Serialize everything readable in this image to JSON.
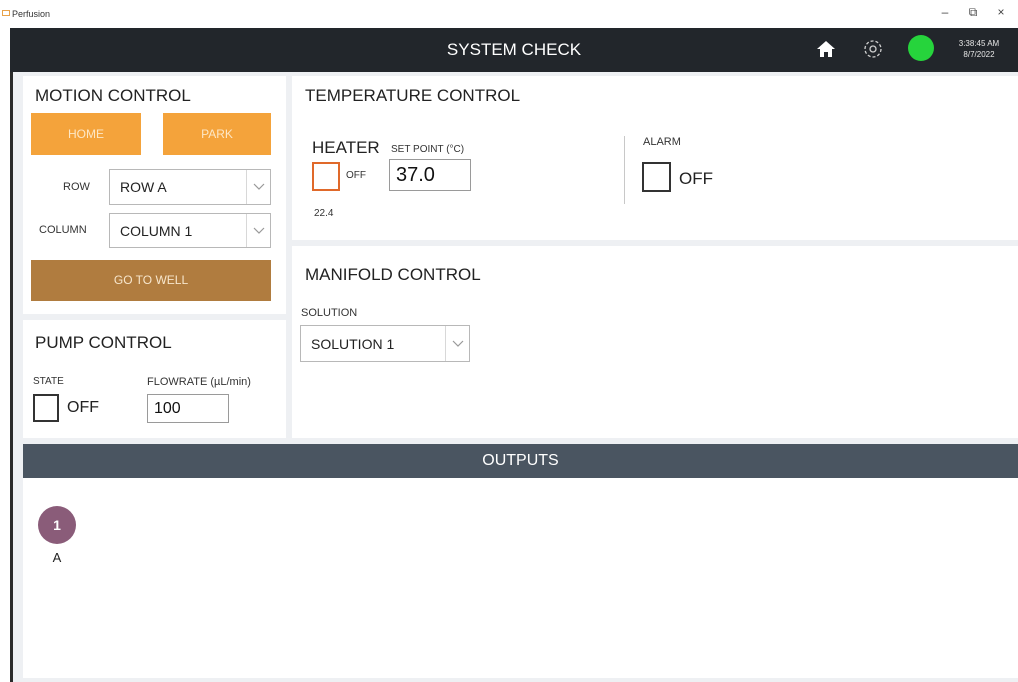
{
  "window": {
    "app_title": "Perfusion",
    "minimize": "–",
    "restore": "⧉",
    "close": "×"
  },
  "header": {
    "title": "SYSTEM CHECK",
    "time": "3:38:45 AM",
    "date": "8/7/2022",
    "status_color": "#26d43c",
    "icons": [
      "home-icon",
      "gear-icon"
    ]
  },
  "motion_control": {
    "title": "MOTION CONTROL",
    "home_label": "HOME",
    "park_label": "PARK",
    "row_label": "ROW",
    "row_value": "ROW A",
    "column_label": "COLUMN",
    "column_value": "COLUMN 1",
    "go_to_well_label": "GO TO WELL"
  },
  "pump_control": {
    "title": "PUMP CONTROL",
    "state_label": "STATE",
    "state_value": "OFF",
    "flowrate_label": "FLOWRATE (µL/min)",
    "flowrate_value": "100"
  },
  "temperature_control": {
    "title": "TEMPERATURE CONTROL",
    "heater_label": "HEATER",
    "heater_state": "OFF",
    "setpoint_label": "SET POINT (°C)",
    "setpoint_value": "37.0",
    "current_temp": "22.4",
    "alarm_label": "ALARM",
    "alarm_state": "OFF"
  },
  "manifold_control": {
    "title": "MANIFOLD CONTROL",
    "solution_label": "SOLUTION",
    "solution_value": "SOLUTION 1"
  },
  "outputs": {
    "title": "OUTPUTS",
    "wells": [
      {
        "number": "1",
        "label": "A",
        "color": "#8a5c79"
      }
    ]
  },
  "colors": {
    "accent_orange": "#f4a33b",
    "accent_brown": "#b07c3f",
    "header_bg": "#22262b",
    "outputs_bar": "#4a5561",
    "heater_checkbox": "#e0692a"
  }
}
